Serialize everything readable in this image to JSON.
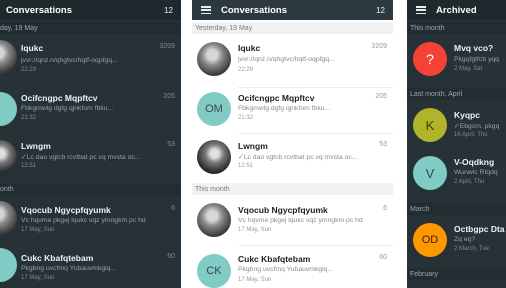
{
  "panel1": {
    "title": "Conversations",
    "count": "12",
    "sections": [
      "day, 19 May",
      "onth"
    ],
    "rows": [
      {
        "name": "Iqukc",
        "msg": "jvvr://qnz.n/qhgtvc/hqtf-oqpfgq...",
        "time": "22:29",
        "count": "3209"
      },
      {
        "name": "Ocifcngpc Mqpftcv",
        "msg": "Fbkgmwlg dgfg qjnkfom fbku...",
        "time": "21:32",
        "count": "205",
        "initials": "OM"
      },
      {
        "name": "Lwngm",
        "msg": "Lc dao vgtcb rcvtbat pc vq mvsta oc...",
        "time": "12:51",
        "count": "53"
      },
      {
        "name": "Vqocub Ngycpfqyumk",
        "msg": "Vc hqvme pkgej lqukc vqz ymngkm pc hd",
        "time": "17 May, Sun",
        "count": "6"
      },
      {
        "name": "Cukc Kbafqtebam",
        "msg": "Pkgbng uvcfmq Yubauvmkgiq...",
        "time": "17 May, Sun",
        "count": "60"
      }
    ]
  },
  "panel2": {
    "title": "Conversations",
    "count": "12",
    "sections": [
      "Yesterday, 19 May",
      "This month"
    ],
    "rows": [
      {
        "name": "Iqukc",
        "msg": "jvvr://qnz.n/qhgtvc/hqtf-oqpfgq...",
        "time": "22:29",
        "count": "3209"
      },
      {
        "name": "Ocifcngpc Mqpftcv",
        "msg": "Fbkgmwlg dgfg qjnkfom fbku...",
        "time": "21:32",
        "count": "205",
        "initials": "OM"
      },
      {
        "name": "Lwngm",
        "msg": "Lc dao vgtcb rcvtbat pc vq mvsta oc...",
        "time": "12:51",
        "count": "53"
      },
      {
        "name": "Vqocub Ngycpfqyumk",
        "msg": "Vc hqvme pkgej lqukc vqz ymngkm pc hd",
        "time": "17 May, Sun",
        "count": "6"
      },
      {
        "name": "Cukc Kbafqtebam",
        "msg": "Pkgbng uvcfmq Yubauvmkgiq...",
        "time": "17 May, Sun",
        "count": "60",
        "initials": "CK"
      }
    ]
  },
  "panel3": {
    "title": "Archived",
    "sections": [
      "This month",
      "Last month, April",
      "March",
      "February"
    ],
    "rows": [
      {
        "name": "Mvq vco?",
        "msg": "Pkgqfgtfcb yqq",
        "time": "2 May, Sat",
        "initials": "?",
        "color": "#f44336"
      },
      {
        "name": "Kyqpc",
        "msg": "Ebgsm, pkgq",
        "time": "16 April, Thu",
        "initials": "K",
        "color": "#afb42b"
      },
      {
        "name": "V-Oqdkng",
        "msg": "Wunwic Rtqdq",
        "time": "2 April, Thu",
        "initials": "V",
        "color": "#80cbc4"
      },
      {
        "name": "Octbgpc Dta",
        "msg": "Zq eq?",
        "time": "2 March, Tue",
        "initials": "OD",
        "color": "#ff9800"
      }
    ]
  },
  "colors": {
    "dark_bg": "#273237",
    "appbar_dark": "#1e282d",
    "teal_avatar": "#80cbc4"
  }
}
